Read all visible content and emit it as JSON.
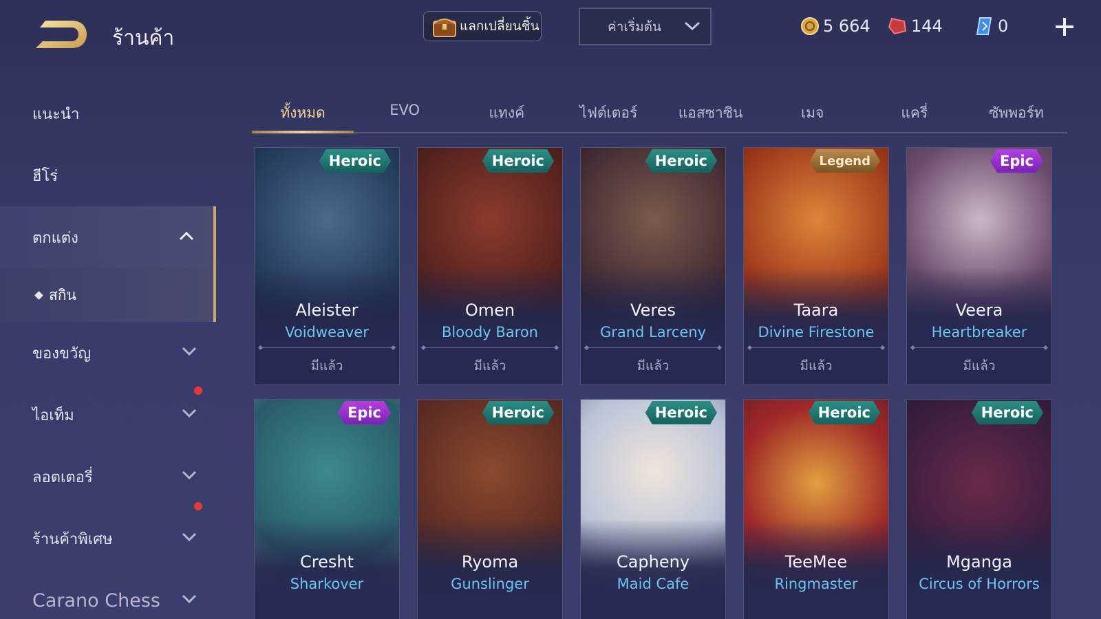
{
  "header": {
    "title": "ร้านค้า",
    "exchange_label": "แลกเปลี่ยนชิ้น",
    "sort_selected": "ค่าเริ่มต้น",
    "currencies": [
      {
        "icon": "gold-coin-icon",
        "value": "5 664"
      },
      {
        "icon": "red-voucher-icon",
        "value": "144"
      },
      {
        "icon": "blue-ticket-icon",
        "value": "0"
      }
    ]
  },
  "sidebar": {
    "items": [
      {
        "label": "แนะนำ"
      },
      {
        "label": "ฮีโร่"
      },
      {
        "label": "ตกแต่ง"
      },
      {
        "label": "สกิน"
      },
      {
        "label": "ของขวัญ"
      },
      {
        "label": "ไอเท็ม"
      },
      {
        "label": "ลอตเตอรี่"
      },
      {
        "label": "ร้านค้าพิเศษ"
      },
      {
        "label": "Carano Chess"
      }
    ]
  },
  "tabs": [
    "ทั้งหมด",
    "EVO",
    "แทงค์",
    "ไฟต์เตอร์",
    "แอสซาซิน",
    "เมจ",
    "แครี่",
    "ซัพพอร์ท"
  ],
  "cards": [
    {
      "hero": "Aleister",
      "skin": "Voidweaver",
      "tier": "Heroic",
      "status": "มีแล้ว"
    },
    {
      "hero": "Omen",
      "skin": "Bloody Baron",
      "tier": "Heroic",
      "status": "มีแล้ว"
    },
    {
      "hero": "Veres",
      "skin": "Grand Larceny",
      "tier": "Heroic",
      "status": "มีแล้ว"
    },
    {
      "hero": "Taara",
      "skin": "Divine Firestone",
      "tier": "Legend",
      "status": "มีแล้ว"
    },
    {
      "hero": "Veera",
      "skin": "Heartbreaker",
      "tier": "Epic",
      "status": "มีแล้ว"
    },
    {
      "hero": "Cresht",
      "skin": "Sharkover",
      "tier": "Epic",
      "status": ""
    },
    {
      "hero": "Ryoma",
      "skin": "Gunslinger",
      "tier": "Heroic",
      "status": ""
    },
    {
      "hero": "Capheny",
      "skin": "Maid Cafe",
      "tier": "Heroic",
      "status": ""
    },
    {
      "hero": "TeeMee",
      "skin": "Ringmaster",
      "tier": "Heroic",
      "status": ""
    },
    {
      "hero": "Mganga",
      "skin": "Circus of Horrors",
      "tier": "Heroic",
      "status": ""
    }
  ],
  "colors": {
    "accent_gold": "#f4d39b",
    "skin_name_blue": "#6cc4f0",
    "heroic_badge": "#2b8f86",
    "epic_badge": "#b43fe0",
    "legend_badge": "#b98d4d",
    "notification_dot": "#e23a37"
  }
}
